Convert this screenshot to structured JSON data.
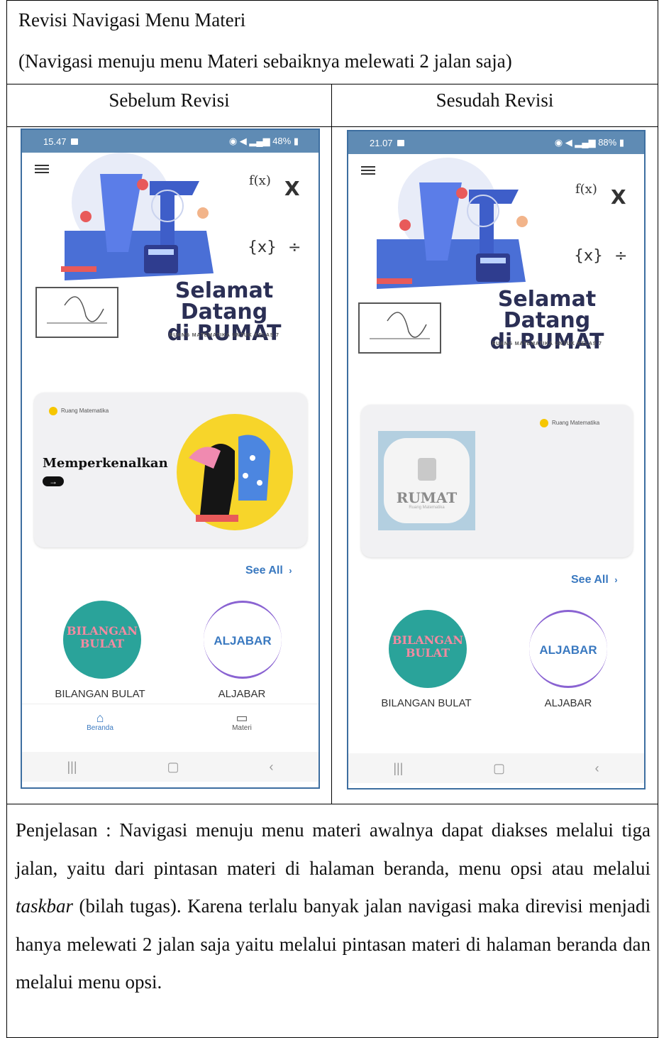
{
  "header": {
    "line1": "Revisi Navigasi Menu Materi",
    "line2": "(Navigasi menuju menu Materi sebaiknya melewati 2 jalan saja)"
  },
  "columns": {
    "before": "Sebelum Revisi",
    "after": "Sesudah Revisi"
  },
  "before_phone": {
    "time": "15.47",
    "status_right": "48%",
    "welcome_line1": "Selamat Datang",
    "welcome_line2": "di RUMAT",
    "welcome_sub": "RUANG MATEMATIKA UNTUK KELAS 7",
    "card_label": "Ruang Matematika",
    "card_title": "Memperkenalkan",
    "see_all": "See All",
    "topic1_label": "BILANGAN BULAT",
    "topic2_label": "ALJABAR",
    "topic1_badge_1": "BILANGAN",
    "topic1_badge_2": "BULAT",
    "topic2_badge": "ALJABAR",
    "tab1": "Beranda",
    "tab2": "Materi"
  },
  "after_phone": {
    "time": "21.07",
    "status_right": "88%",
    "welcome_line1": "Selamat Datang",
    "welcome_line2": "di RUMAT",
    "welcome_sub": "RUANG MATEMATIKA UNTUK KELAS 7",
    "card_label": "Ruang Matematika",
    "logo_title": "RUMAT",
    "logo_sub": "Ruang Matematika",
    "see_all": "See All",
    "topic1_label": "BILANGAN BULAT",
    "topic2_label": "ALJABAR",
    "topic1_badge_1": "BILANGAN",
    "topic1_badge_2": "BULAT",
    "topic2_badge": "ALJABAR"
  },
  "explanation": {
    "before_italic": "Penjelasan : Navigasi menuju menu materi awalnya dapat diakses melalui tiga jalan, yaitu dari pintasan materi di halaman beranda, menu opsi atau melalui ",
    "italic": "taskbar",
    "after_italic": " (bilah tugas). Karena terlalu banyak jalan navigasi maka direvisi menjadi hanya melewati 2 jalan saja yaitu melalui pintasan materi di halaman beranda dan  melalui menu opsi."
  },
  "colors": {
    "status_bar": "#5f8bb4",
    "link_blue": "#3a79c0",
    "teal_badge": "#2aa39a",
    "purple_badge": "#8a63d2",
    "yellow": "#f6c600"
  }
}
